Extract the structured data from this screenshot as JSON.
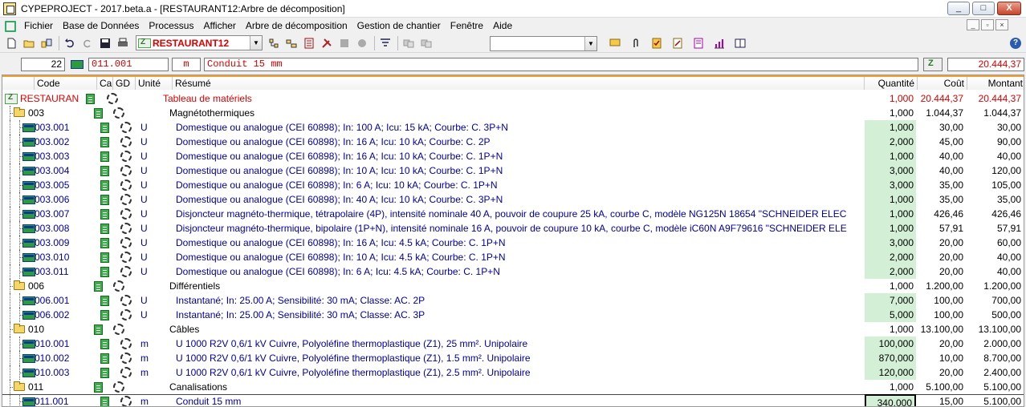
{
  "window": {
    "title": "CYPEPROJECT - 2017.beta.a - [RESTAURANT12:Arbre de décomposition]",
    "controls": [
      "_",
      "□",
      "X"
    ]
  },
  "menu": [
    "Fichier",
    "Base de Données",
    "Processus",
    "Afficher",
    "Arbre de décomposition",
    "Gestion de chantier",
    "Fenêtre",
    "Aide"
  ],
  "toolbar": {
    "project": "RESTAURANT12"
  },
  "infobar": {
    "line_number": "22",
    "code": "011.001",
    "unit": "m",
    "summary": "Conduit 15 mm",
    "total": "20.444,37"
  },
  "columns": {
    "code": "Code",
    "ca": "Ca",
    "gd": "GD",
    "unit": "Unité",
    "summary": "Résumé",
    "quantity": "Quantité",
    "cost": "Coût",
    "amount": "Montant"
  },
  "rows": [
    {
      "type": "root",
      "code": "RESTAURAN",
      "unit": "",
      "summary": "Tableau de matériels",
      "quantity": "1,000",
      "cost": "20.444,37",
      "amount": "20.444,37"
    },
    {
      "type": "chapter",
      "code": "003",
      "unit": "",
      "summary": "Magnétothermiques",
      "quantity": "1,000",
      "cost": "1.044,37",
      "amount": "1.044,37"
    },
    {
      "type": "item",
      "code": "003.001",
      "unit": "U",
      "summary": "Domestique ou analogue (CEI 60898); In: 100 A; Icu: 15 kA; Courbe: C. 3P+N",
      "quantity": "1,000",
      "cost": "30,00",
      "amount": "30,00"
    },
    {
      "type": "item",
      "code": "003.002",
      "unit": "U",
      "summary": "Domestique ou analogue (CEI 60898); In: 16 A; Icu: 10 kA; Courbe: C. 2P",
      "quantity": "2,000",
      "cost": "45,00",
      "amount": "90,00"
    },
    {
      "type": "item",
      "code": "003.003",
      "unit": "U",
      "summary": "Domestique ou analogue (CEI 60898); In: 16 A; Icu: 10 kA; Courbe: C. 1P+N",
      "quantity": "1,000",
      "cost": "40,00",
      "amount": "40,00"
    },
    {
      "type": "item",
      "code": "003.004",
      "unit": "U",
      "summary": "Domestique ou analogue (CEI 60898); In: 10 A; Icu: 10 kA; Courbe: C. 1P+N",
      "quantity": "3,000",
      "cost": "40,00",
      "amount": "120,00"
    },
    {
      "type": "item",
      "code": "003.005",
      "unit": "U",
      "summary": "Domestique ou analogue (CEI 60898); In: 6 A; Icu: 10 kA; Courbe: C. 1P+N",
      "quantity": "3,000",
      "cost": "35,00",
      "amount": "105,00"
    },
    {
      "type": "item",
      "code": "003.006",
      "unit": "U",
      "summary": "Domestique ou analogue (CEI 60898); In: 40 A; Icu: 10 kA; Courbe: C. 3P+N",
      "quantity": "1,000",
      "cost": "35,00",
      "amount": "35,00"
    },
    {
      "type": "item",
      "code": "003.007",
      "unit": "U",
      "summary": "Disjoncteur magnéto-thermique, tétrapolaire (4P), intensité nominale 40 A, pouvoir de coupure 25 kA, courbe C, modèle NG125N 18654 \"SCHNEIDER ELEC",
      "quantity": "1,000",
      "cost": "426,46",
      "amount": "426,46"
    },
    {
      "type": "item",
      "code": "003.008",
      "unit": "U",
      "summary": "Disjoncteur magnéto-thermique, bipolaire (1P+N), intensité nominale 16 A, pouvoir de coupure 10 kA, courbe C, modèle iC60N A9F79616 \"SCHNEIDER ELE",
      "quantity": "1,000",
      "cost": "57,91",
      "amount": "57,91"
    },
    {
      "type": "item",
      "code": "003.009",
      "unit": "U",
      "summary": "Domestique ou analogue (CEI 60898); In: 16 A; Icu: 4.5 kA; Courbe: C. 1P+N",
      "quantity": "3,000",
      "cost": "20,00",
      "amount": "60,00"
    },
    {
      "type": "item",
      "code": "003.010",
      "unit": "U",
      "summary": "Domestique ou analogue (CEI 60898); In: 10 A; Icu: 4.5 kA; Courbe: C. 1P+N",
      "quantity": "2,000",
      "cost": "20,00",
      "amount": "40,00"
    },
    {
      "type": "item",
      "code": "003.011",
      "unit": "U",
      "summary": "Domestique ou analogue (CEI 60898); In: 6 A; Icu: 4.5 kA; Courbe: C. 1P+N",
      "quantity": "2,000",
      "cost": "20,00",
      "amount": "40,00"
    },
    {
      "type": "chapter",
      "code": "006",
      "unit": "",
      "summary": "Différentiels",
      "quantity": "1,000",
      "cost": "1.200,00",
      "amount": "1.200,00"
    },
    {
      "type": "item",
      "code": "006.001",
      "unit": "U",
      "summary": "Instantané; In: 25.00 A; Sensibilité: 30 mA; Classe: AC. 2P",
      "quantity": "7,000",
      "cost": "100,00",
      "amount": "700,00"
    },
    {
      "type": "item",
      "code": "006.002",
      "unit": "U",
      "summary": "Instantané; In: 25.00 A; Sensibilité: 30 mA; Classe: AC. 3P",
      "quantity": "5,000",
      "cost": "100,00",
      "amount": "500,00"
    },
    {
      "type": "chapter",
      "code": "010",
      "unit": "",
      "summary": "Câbles",
      "quantity": "1,000",
      "cost": "13.100,00",
      "amount": "13.100,00"
    },
    {
      "type": "item",
      "code": "010.001",
      "unit": "m",
      "summary": "U 1000 R2V 0,6/1 kV Cuivre, Polyoléfine thermoplastique (Z1), 25 mm². Unipolaire",
      "quantity": "100,000",
      "cost": "20,00",
      "amount": "2.000,00"
    },
    {
      "type": "item",
      "code": "010.002",
      "unit": "m",
      "summary": "U 1000 R2V 0,6/1 kV Cuivre, Polyoléfine thermoplastique (Z1), 1.5 mm². Unipolaire",
      "quantity": "870,000",
      "cost": "10,00",
      "amount": "8.700,00"
    },
    {
      "type": "item",
      "code": "010.003",
      "unit": "m",
      "summary": "U 1000 R2V 0,6/1 kV Cuivre, Polyoléfine thermoplastique (Z1), 2.5 mm². Unipolaire",
      "quantity": "120,000",
      "cost": "20,00",
      "amount": "2.400,00"
    },
    {
      "type": "chapter",
      "code": "011",
      "unit": "",
      "summary": "Canalisations",
      "quantity": "1,000",
      "cost": "5.100,00",
      "amount": "5.100,00"
    },
    {
      "type": "item",
      "code": "011.001",
      "unit": "m",
      "summary": "Conduit 15 mm",
      "quantity": "340,000",
      "cost": "15,00",
      "amount": "5.100,00",
      "selected": true
    }
  ]
}
